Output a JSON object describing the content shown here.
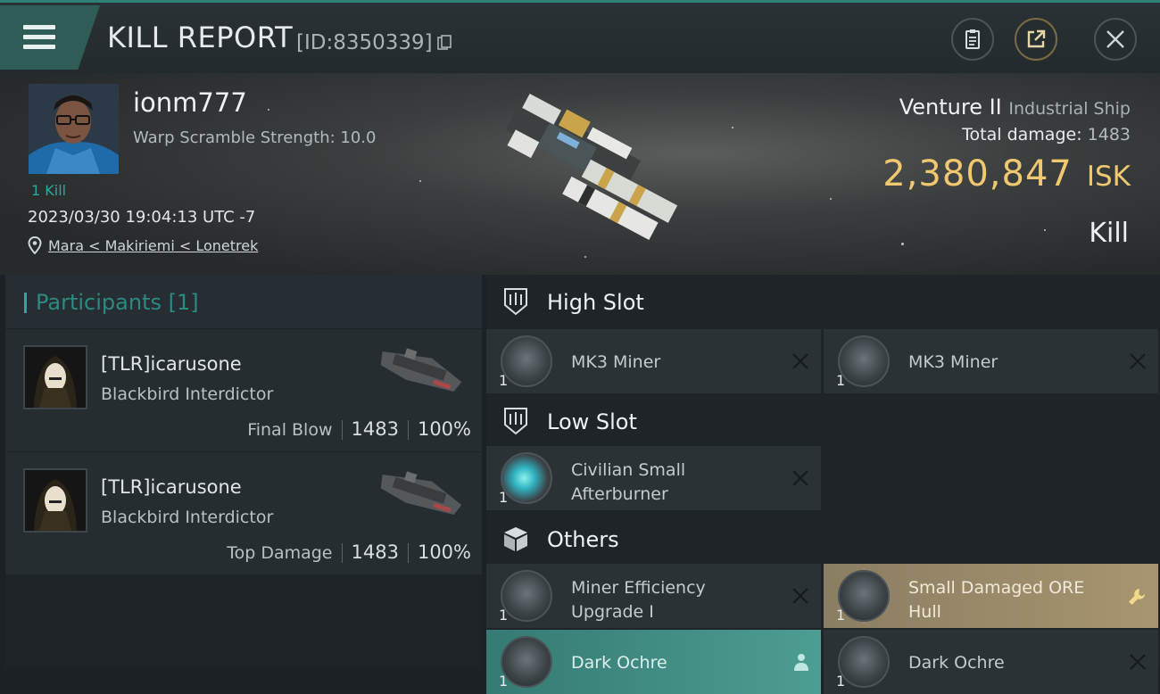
{
  "header": {
    "title": "KILL REPORT",
    "report_id": "[ID:8350339]"
  },
  "victim": {
    "name": "ionm777",
    "warp_scramble": "Warp Scramble Strength: 10.0",
    "kills": "1 Kill",
    "datetime": "2023/03/30 19:04:13 UTC -7",
    "location": "Mara < Makiriemi < Lonetrek",
    "ship_name": "Venture II",
    "ship_class": "Industrial Ship",
    "total_damage_label": "Total damage:",
    "total_damage": "1483",
    "isk_value": "2,380,847",
    "isk_unit": "ISK",
    "result": "Kill"
  },
  "participants": {
    "title": "Participants [1]",
    "rows": [
      {
        "name": "[TLR]icarusone",
        "ship": "Blackbird Interdictor",
        "role": "Final Blow",
        "damage": "1483",
        "percent": "100%"
      },
      {
        "name": "[TLR]icarusone",
        "ship": "Blackbird Interdictor",
        "role": "Top Damage",
        "damage": "1483",
        "percent": "100%"
      }
    ]
  },
  "sections": {
    "high": {
      "title": "High Slot",
      "items": [
        {
          "name": "MK3 Miner",
          "qty": "1"
        },
        {
          "name": "MK3 Miner",
          "qty": "1"
        }
      ]
    },
    "low": {
      "title": "Low Slot",
      "items": [
        {
          "name": "Civilian Small Afterburner",
          "qty": "1"
        }
      ]
    },
    "others": {
      "title": "Others",
      "items": [
        {
          "name": "Miner Efficiency Upgrade I",
          "qty": "1"
        },
        {
          "name": "Small Damaged ORE Hull",
          "qty": "1"
        },
        {
          "name": "Dark Ochre",
          "qty": "1"
        },
        {
          "name": "Dark Ochre",
          "qty": "1"
        }
      ]
    }
  },
  "colors": {
    "accent_teal": "#2fa79c",
    "isk_gold": "#f0c870",
    "gold_slot": "#a89570"
  }
}
